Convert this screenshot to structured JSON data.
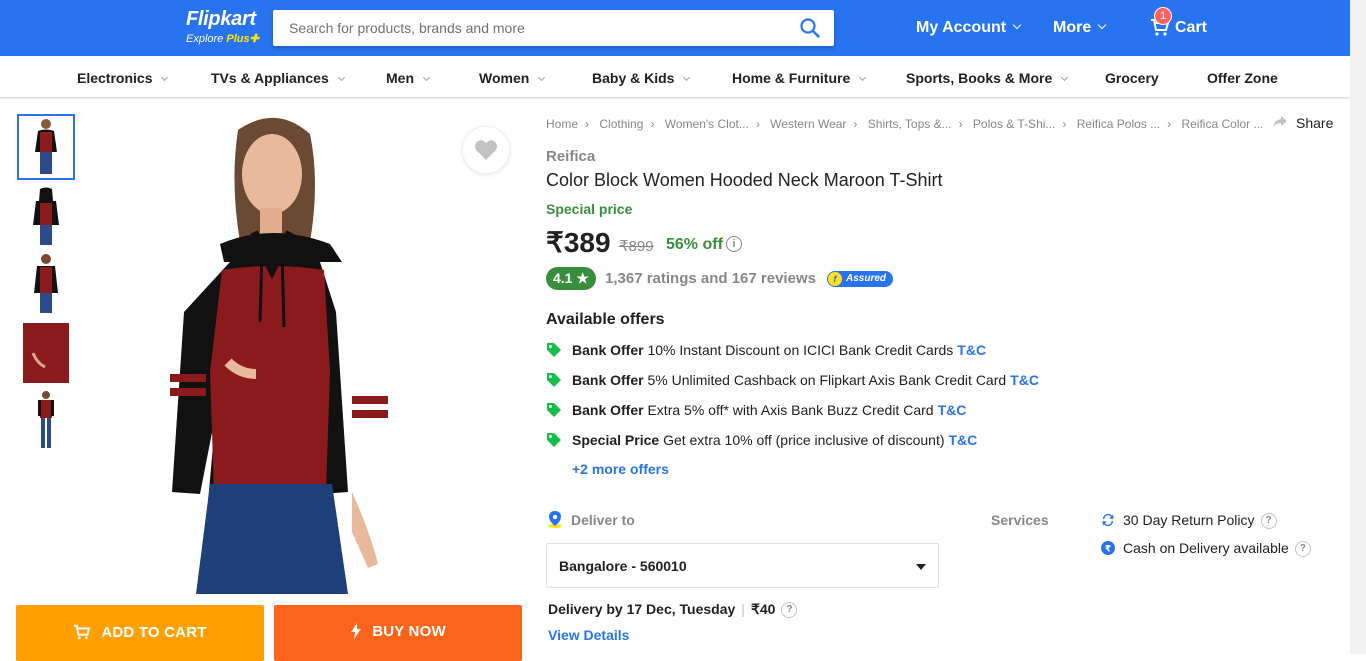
{
  "header": {
    "logo_text": "Flipkart",
    "logo_tagline": "Explore",
    "logo_tagline_plus": "Plus",
    "search_placeholder": "Search for products, brands and more",
    "my_account": "My Account",
    "more": "More",
    "cart": "Cart",
    "cart_count": "1"
  },
  "categories": [
    "Electronics",
    "TVs & Appliances",
    "Men",
    "Women",
    "Baby & Kids",
    "Home & Furniture",
    "Sports, Books & More",
    "Grocery",
    "Offer Zone"
  ],
  "breadcrumbs": [
    "Home",
    "Clothing",
    "Women's Clot...",
    "Western Wear",
    "Shirts, Tops &...",
    "Polos & T-Shi...",
    "Reifica Polos ...",
    "Reifica Color ..."
  ],
  "share_label": "Share",
  "product": {
    "brand": "Reifica",
    "title": "Color Block Women Hooded Neck Maroon T-Shirt",
    "special_label": "Special price",
    "price": "₹389",
    "mrp": "₹899",
    "discount": "56% off",
    "rating": "4.1",
    "rating_star": "★",
    "ratings_text": "1,367 ratings and 167 reviews",
    "assured_label": "Assured"
  },
  "offers": {
    "heading": "Available offers",
    "items": [
      {
        "type": "Bank Offer",
        "text": "10% Instant Discount on ICICI Bank Credit Cards",
        "tc": "T&C"
      },
      {
        "type": "Bank Offer",
        "text": "5% Unlimited Cashback on Flipkart Axis Bank Credit Card",
        "tc": "T&C"
      },
      {
        "type": "Bank Offer",
        "text": "Extra 5% off* with Axis Bank Buzz Credit Card",
        "tc": "T&C"
      },
      {
        "type": "Special Price",
        "text": "Get extra 10% off (price inclusive of discount)",
        "tc": "T&C"
      }
    ],
    "more": "+2 more offers"
  },
  "delivery": {
    "heading": "Deliver to",
    "pincode": "Bangalore - 560010",
    "date": "Delivery by 17 Dec, Tuesday",
    "charge": "₹40",
    "view_details": "View Details"
  },
  "services": {
    "heading": "Services",
    "items": [
      "30 Day Return Policy",
      "Cash on Delivery available"
    ]
  },
  "buttons": {
    "add_to_cart": "ADD TO CART",
    "buy_now": "BUY NOW"
  },
  "colors": {
    "brand_blue": "#2874f0",
    "green": "#388e3c",
    "orange_cart": "#ff9f00",
    "orange_buy": "#fb641b",
    "maroon": "#8b1a1d"
  }
}
